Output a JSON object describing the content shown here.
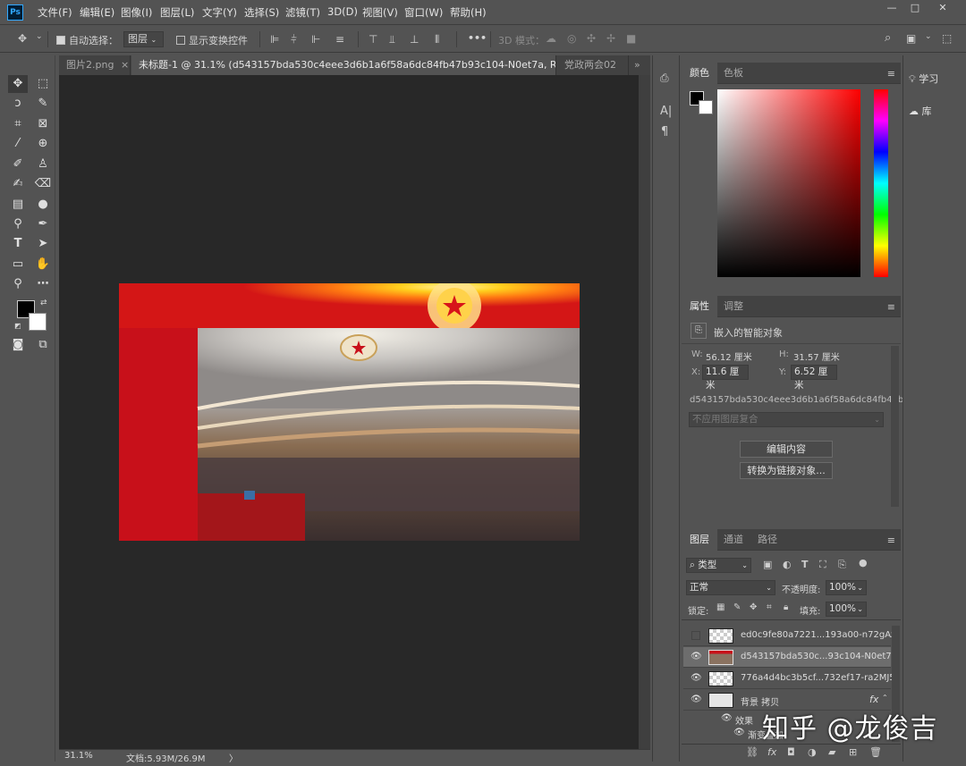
{
  "app": {
    "logo": "Ps"
  },
  "menu": [
    "文件(F)",
    "编辑(E)",
    "图像(I)",
    "图层(L)",
    "文字(Y)",
    "选择(S)",
    "滤镜(T)",
    "3D(D)",
    "视图(V)",
    "窗口(W)",
    "帮助(H)"
  ],
  "window": {
    "minimize": "—",
    "maximize": "□",
    "close": "✕"
  },
  "options": {
    "auto_select_label": "自动选择：",
    "auto_select_value": "图层",
    "show_transform_label": "显示变换控件",
    "more": "•••",
    "mode_3d": "3D 模式："
  },
  "tabs": [
    {
      "label": "图片2.png",
      "close": "×"
    },
    {
      "label": "未标题-1 @ 31.1% (d543157bda530c4eee3d6b1a6f58a6dc84fb47b93c104-N0et7a, RGB/8#) *",
      "close": "×"
    },
    {
      "label": "党政两会02"
    }
  ],
  "tabs_overflow": "»",
  "status": {
    "zoom": "31.1%",
    "doc": "文档:5.93M/26.9M",
    "arrow": "〉"
  },
  "color_panel": {
    "tabs": [
      "颜色",
      "色板"
    ]
  },
  "properties": {
    "tabs": [
      "属性",
      "调整"
    ],
    "type": "嵌入的智能对象",
    "w_label": "W:",
    "w_value": "56.12 厘米",
    "h_label": "H:",
    "h_value": "31.57 厘米",
    "x_label": "X:",
    "x_value": "11.6 厘米",
    "y_label": "Y:",
    "y_value": "6.52 厘米",
    "filename": "d543157bda530c4eee3d6b1a6f58a6dc84fb47b...",
    "comp_placeholder": "不应用图层复合",
    "edit_button": "编辑内容",
    "convert_button": "转换为链接对象..."
  },
  "layers_panel": {
    "tabs": [
      "图层",
      "通道",
      "路径"
    ],
    "filter_kind": "类型",
    "blend_mode": "正常",
    "opacity_label": "不透明度:",
    "opacity_value": "100%",
    "lock_label": "锁定:",
    "fill_label": "填充:",
    "fill_value": "100%",
    "layers": [
      {
        "name": "ed0c9fe80a7221...193a00-n72gAz",
        "visible": false
      },
      {
        "name": "d543157bda530c...93c104-N0et7a",
        "visible": true,
        "active": true
      },
      {
        "name": "776a4d4bc3b5cf...732ef17-ra2MJ5",
        "visible": true
      },
      {
        "name": "背景 拷贝",
        "visible": true,
        "fx": "fx"
      },
      {
        "name": "效果",
        "visible": true
      },
      {
        "name": "渐变叠加",
        "visible": true
      }
    ]
  },
  "side_panel": {
    "learn": "学习",
    "library": "库"
  },
  "watermark": "知乎 @龙俊吉"
}
